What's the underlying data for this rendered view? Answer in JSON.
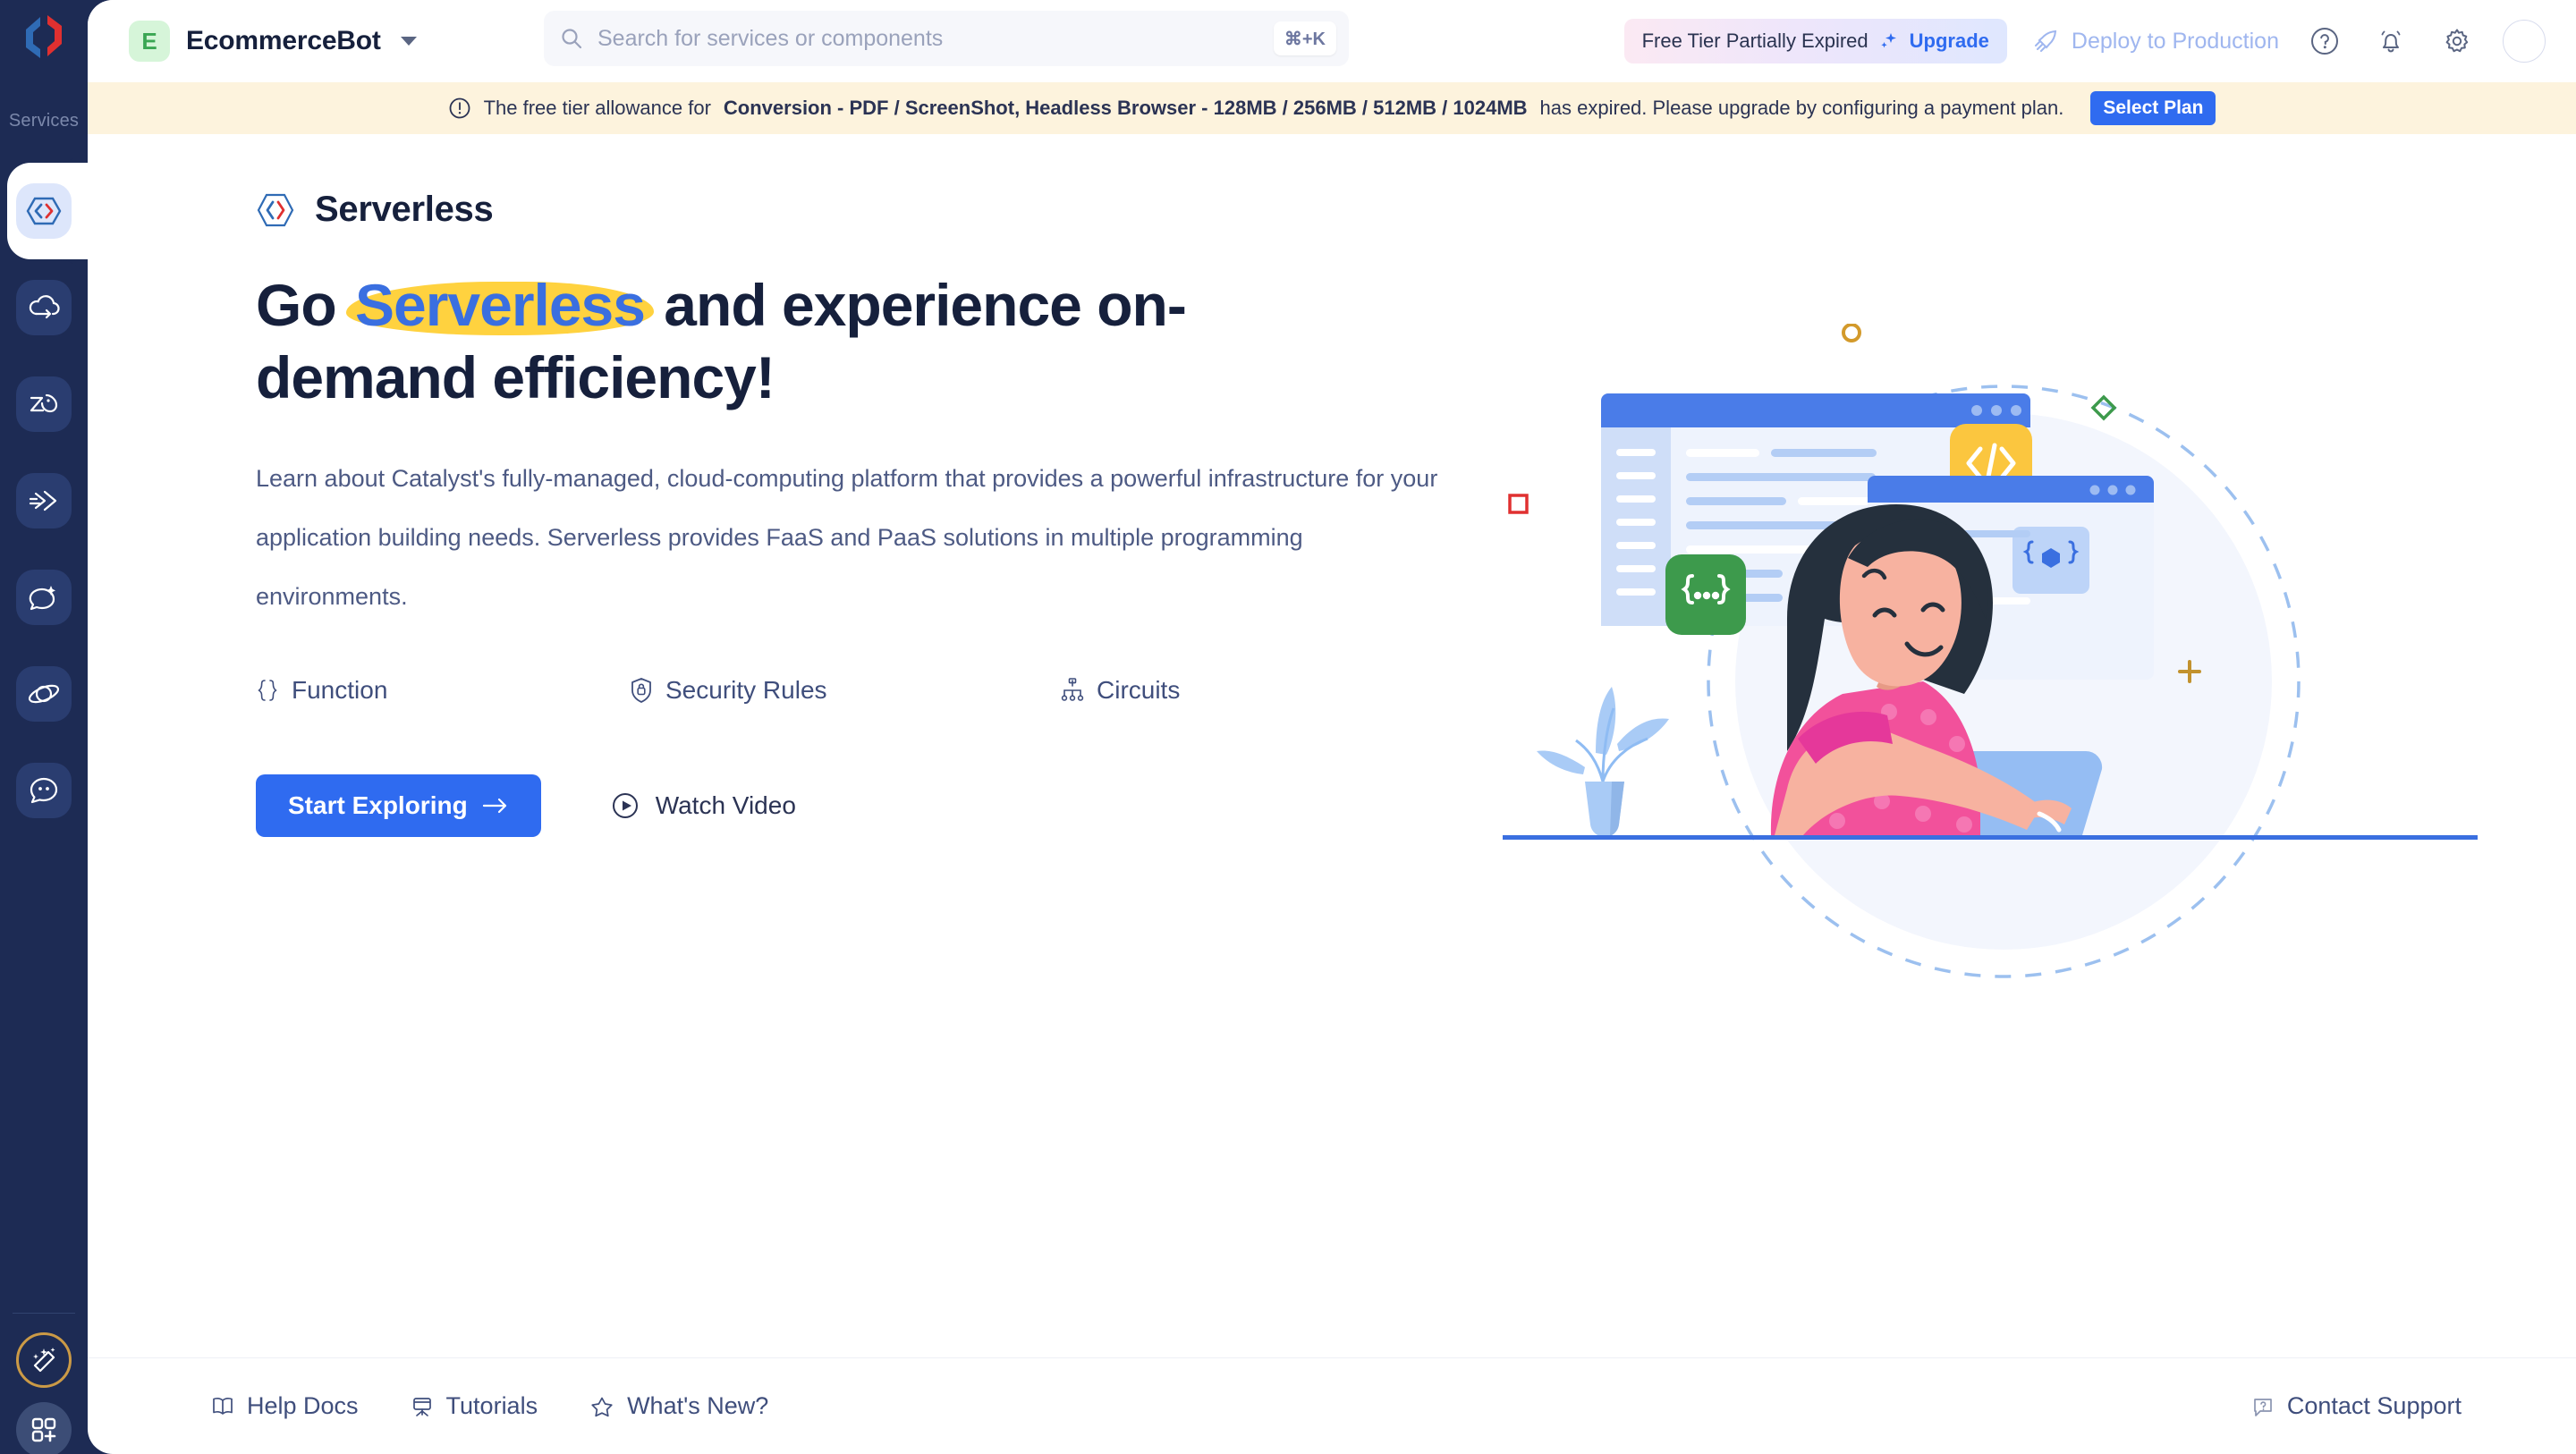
{
  "rail": {
    "logo_icon": "catalyst-logo-icon",
    "services_label": "Services",
    "items": [
      {
        "name": "serverless",
        "icon": "code-brackets-icon",
        "active": true
      },
      {
        "name": "cloud-scale",
        "icon": "cloud-arrow-icon",
        "active": false
      },
      {
        "name": "data-store",
        "icon": "data-zia-icon",
        "active": false
      },
      {
        "name": "integrations",
        "icon": "connect-arrows-icon",
        "active": false
      },
      {
        "name": "ai-insights",
        "icon": "chat-sparkle-icon",
        "active": false
      },
      {
        "name": "orbit",
        "icon": "orbit-icon",
        "active": false
      },
      {
        "name": "conversations",
        "icon": "chat-bubble-dots-icon",
        "active": false
      }
    ],
    "bottom": [
      {
        "name": "magic-assistant",
        "icon": "magic-wand-icon"
      },
      {
        "name": "app-switcher",
        "icon": "apps-grid-plus-icon"
      }
    ]
  },
  "header": {
    "org_initial": "E",
    "org_name": "EcommerceBot",
    "org_caret_icon": "chevron-down-icon",
    "search": {
      "icon": "search-icon",
      "placeholder": "Search for services or components",
      "value": "",
      "shortcut": "⌘+K"
    },
    "tier": {
      "label": "Free Tier Partially Expired",
      "upgrade_label": "Upgrade",
      "upgrade_icon": "sparkle-icon"
    },
    "deploy": {
      "label": "Deploy to Production",
      "icon": "rocket-icon"
    },
    "actions": [
      {
        "name": "help-icon",
        "glyph": "?"
      },
      {
        "name": "notifications-bell-icon",
        "glyph": "bell"
      },
      {
        "name": "settings-gear-icon",
        "glyph": "gear"
      }
    ],
    "avatar_name": "user-avatar"
  },
  "banner": {
    "icon": "alert-circle-icon",
    "text_before": "The free tier allowance for",
    "bold_text": "Conversion - PDF / ScreenShot, Headless Browser - 128MB / 256MB / 512MB / 1024MB",
    "text_after": "has expired. Please upgrade by configuring a payment plan.",
    "button_label": "Select Plan"
  },
  "hero": {
    "brand_icon": "serverless-hex-icon",
    "brand_name": "Serverless",
    "title_part1": "Go ",
    "title_highlight": "Serverless",
    "title_part2": " and experience on-demand efficiency!",
    "paragraph": "Learn about Catalyst's fully-managed, cloud-computing platform that provides a powerful infrastructure for your application building needs. Serverless provides FaaS and PaaS solutions in multiple programming environments.",
    "features": [
      {
        "label": "Function",
        "icon": "curly-braces-icon"
      },
      {
        "label": "Security Rules",
        "icon": "shield-lock-icon"
      },
      {
        "label": "Circuits",
        "icon": "circuit-hierarchy-icon"
      }
    ],
    "primary_cta": {
      "label": "Start Exploring",
      "icon": "arrow-right-icon"
    },
    "secondary_cta": {
      "label": "Watch Video",
      "icon": "play-circle-icon"
    },
    "illustration_name": "developer-at-laptop-illustration"
  },
  "footer": {
    "links": [
      {
        "label": "Help Docs",
        "icon": "book-icon"
      },
      {
        "label": "Tutorials",
        "icon": "easel-icon"
      },
      {
        "label": "What's New?",
        "icon": "star-icon"
      }
    ],
    "support": {
      "label": "Contact Support",
      "icon": "question-bubble-icon"
    }
  },
  "colors": {
    "rail_bg": "#1d2b54",
    "accent_blue": "#2f6bf0",
    "highlight_yellow": "#ffd23f",
    "banner_bg": "#fdf3dd",
    "text_dark": "#16203c",
    "text_muted": "#4d5a84"
  }
}
